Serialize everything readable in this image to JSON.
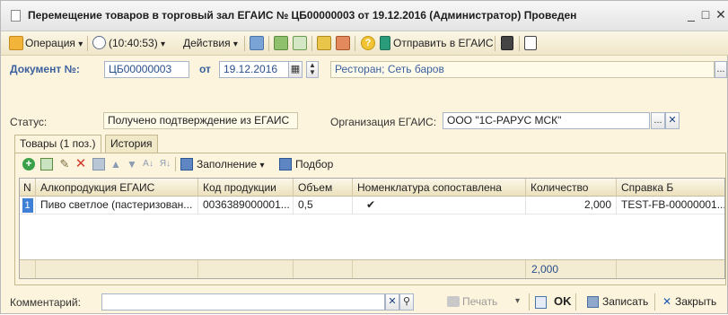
{
  "window": {
    "title": "Перемещение товаров в торговый зал ЕГАИС № ЦБ00000003 от 19.12.2016 (Администратор) Проведен",
    "minimize": "_",
    "maximize": "□",
    "close": "✕"
  },
  "toolbar": {
    "operation": "Операция",
    "time": "(10:40:53)",
    "actions": "Действия",
    "send": "Отправить в ЕГАИС",
    "dropdown_arrow": "▾"
  },
  "header": {
    "doc_number_label": "Документ №:",
    "doc_number": "ЦБ00000003",
    "date_label": "от",
    "date": "19.12.2016",
    "org_unit": "Ресторан; Сеть баров",
    "ellipsis": "..."
  },
  "status_row": {
    "status_label": "Статус:",
    "status_value": "Получено подтверждение из ЕГАИС",
    "org_label": "Организация ЕГАИС:",
    "org_value": "ООО \"1С-РАРУС МСК\"",
    "ellipsis": "...",
    "clear": "✕"
  },
  "tabs": [
    {
      "label": "Товары (1 поз.)",
      "active": true
    },
    {
      "label": "История",
      "active": false
    }
  ],
  "table_toolbar": {
    "fill": "Заполнение",
    "select": "Подбор"
  },
  "table": {
    "columns": [
      "N",
      "Алкопродукция ЕГАИС",
      "Код продукции",
      "Объем",
      "Номенклатура сопоставлена",
      "Количество",
      "Справка Б"
    ],
    "rows": [
      {
        "n": "1",
        "product": "Пиво светлое (пастеризован...",
        "code": "0036389000001...",
        "volume": "0,5",
        "matched": "✔",
        "quantity": "2,000",
        "ref_b": "TEST-FB-00000001..."
      }
    ],
    "footer_quantity": "2,000"
  },
  "bottom": {
    "comment_label": "Комментарий:",
    "comment_value": "",
    "print": "Печать",
    "ok": "OK",
    "save": "Записать",
    "close": "Закрыть"
  },
  "colors": {
    "background": "#fcf4dc",
    "link_blue": "#3a5f9e",
    "selected_row": "#3f7fd6"
  }
}
